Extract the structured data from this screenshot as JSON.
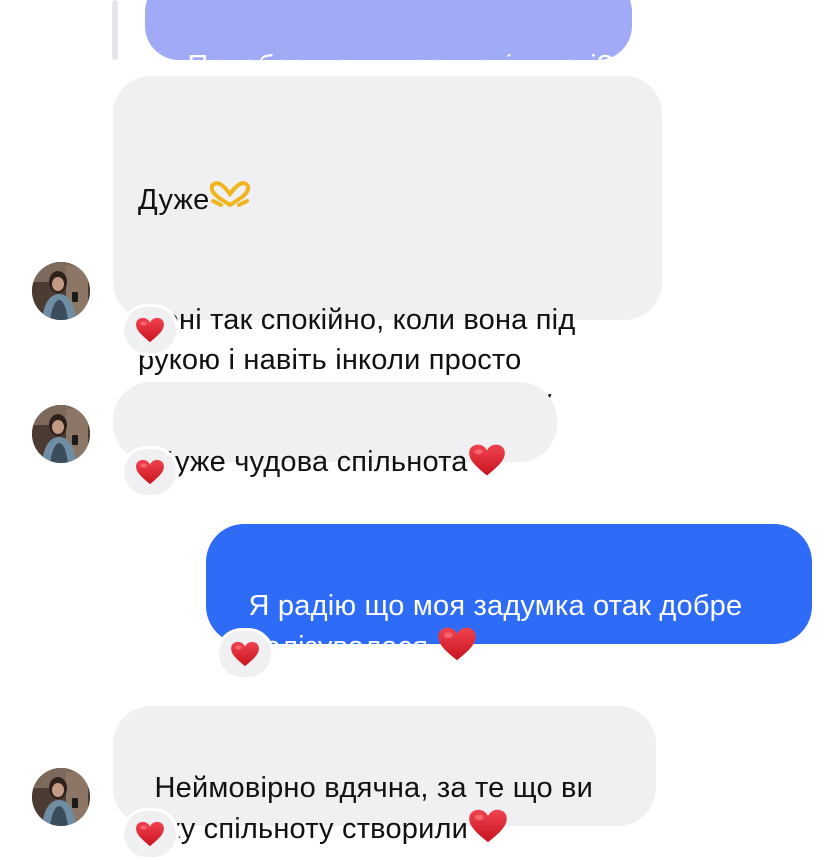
{
  "colors": {
    "outgoing_bubble": "#2e6bf6",
    "incoming_bubble": "#f0f0f3",
    "quoted_bubble": "#a0aaf6",
    "heart": "#e0242f"
  },
  "quoted_message": {
    "text": "Подобається у нас в спільноті?"
  },
  "messages": [
    {
      "sender": "other",
      "line_first": "Дуже",
      "first_emoji": "heart-hands-icon",
      "text": "Мені так спокійно, коли вона під\nрукою і навіть інколи просто\nкорисну інформацію знаходжу,\nнічого не писавши,",
      "reaction": "heart-icon"
    },
    {
      "sender": "other",
      "text": "Дуже чудова спільнота",
      "trailing_emoji": "heart-icon",
      "reaction": "heart-icon"
    },
    {
      "sender": "me",
      "text": "Я радію що моя задумка отак добре\nреалізувалася ",
      "trailing_emoji": "heart-icon",
      "reaction": "heart-icon"
    },
    {
      "sender": "other",
      "text": "Неймовірно вдячна, за те що ви\nтаку спільноту створили",
      "trailing_emoji": "heart-icon",
      "reaction": "heart-icon"
    }
  ]
}
